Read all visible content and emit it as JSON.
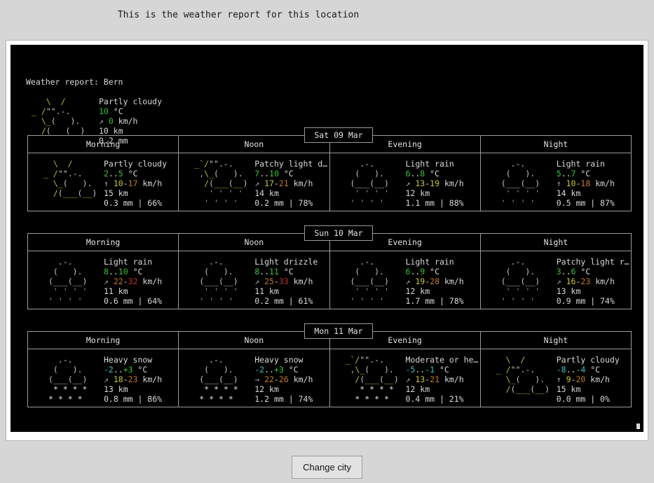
{
  "page": {
    "heading": "This is the weather report for this location",
    "button_label": "Change city"
  },
  "colors": {
    "background": "#d6d6d6",
    "terminal_bg": "#000000",
    "terminal_fg": "#d0d0d0",
    "frame": "#ffffff",
    "green": "#35c135",
    "cyan": "#34c3cb",
    "yellow": "#c7c72f",
    "orange": "#c07a20",
    "red": "#c23030",
    "sun": "#a6c52b"
  },
  "report": {
    "title": "Weather report: Bern",
    "location": "Bern",
    "current": {
      "art": [
        "   \\  /",
        "_ /\"\".-.",
        "  \\_(   ).",
        "  /(___(__)"
      ],
      "condition": "Partly cloudy",
      "temp": "10",
      "temp_unit": "°C",
      "wind_arrow": "↗",
      "wind": "0",
      "wind_unit": "km/h",
      "visibility": "10 km",
      "precip": "0.2 mm"
    }
  },
  "days": [
    {
      "label": "Sat 09 Mar",
      "slots": [
        {
          "name": "Morning",
          "art": [
            "  \\  /",
            "_ /\"\".-.",
            "  \\_(   ).",
            "  /(___(__)"
          ],
          "art_kind": "sun-cloud",
          "condition": "Partly cloudy",
          "temp_low": "2",
          "temp_high": "5",
          "temp_low_color": "green",
          "temp_high_color": "green",
          "temp_text": "2..5 °C",
          "wind_arrow": "↑",
          "wind_low": "10",
          "wind_high": "17",
          "wind_low_color": "yellow",
          "wind_high_color": "orange",
          "wind_text": "10-17 km/h",
          "visibility": "15 km",
          "precip": "0.3 mm | 66%"
        },
        {
          "name": "Noon",
          "art": [
            "_`/\"\".-.",
            " ,\\_(   ).",
            "  /(___(__)",
            "   ' ' ' '",
            "  ' ' ' '"
          ],
          "art_kind": "sun-cloud-rain",
          "condition": "Patchy light d…",
          "temp_low": "7",
          "temp_high": "10",
          "temp_low_color": "green",
          "temp_high_color": "green",
          "temp_text": "7..10 °C",
          "wind_arrow": "↗",
          "wind_low": "17",
          "wind_high": "21",
          "wind_low_color": "yellow",
          "wind_high_color": "orange",
          "wind_text": "17-21 km/h",
          "visibility": "14 km",
          "precip": "0.2 mm | 78%"
        },
        {
          "name": "Evening",
          "art": [
            "   .-.",
            "  (   ).",
            " (___(__)",
            "  ' ' ' '",
            " ' ' ' '"
          ],
          "art_kind": "rain",
          "condition": "Light rain",
          "temp_low": "6",
          "temp_high": "8",
          "temp_low_color": "green",
          "temp_high_color": "green",
          "temp_text": "6..8 °C",
          "wind_arrow": "↗",
          "wind_low": "13",
          "wind_high": "19",
          "wind_low_color": "yellow",
          "wind_high_color": "yellow",
          "wind_text": "13-19 km/h",
          "visibility": "12 km",
          "precip": "1.1 mm | 88%"
        },
        {
          "name": "Night",
          "art": [
            "   .-.",
            "  (   ).",
            " (___(__)",
            "  ' ' ' '",
            " ' ' ' '"
          ],
          "art_kind": "rain",
          "condition": "Light rain",
          "temp_low": "5",
          "temp_high": "7",
          "temp_low_color": "green",
          "temp_high_color": "green",
          "temp_text": "5..7 °C",
          "wind_arrow": "↑",
          "wind_low": "10",
          "wind_high": "18",
          "wind_low_color": "yellow",
          "wind_high_color": "orange",
          "wind_text": "10-18 km/h",
          "visibility": "14 km",
          "precip": "0.5 mm | 87%"
        }
      ]
    },
    {
      "label": "Sun 10 Mar",
      "slots": [
        {
          "name": "Morning",
          "art": [
            "   .-.",
            "  (   ).",
            " (___(__)",
            "  ' ' ' '",
            " ' ' ' '"
          ],
          "art_kind": "rain",
          "condition": "Light rain",
          "temp_low": "8",
          "temp_high": "10",
          "temp_low_color": "green",
          "temp_high_color": "green",
          "temp_text": "8..10 °C",
          "wind_arrow": "↗",
          "wind_low": "22",
          "wind_high": "32",
          "wind_low_color": "orange",
          "wind_high_color": "red",
          "wind_text": "22-32 km/h",
          "visibility": "11 km",
          "precip": "0.6 mm | 64%"
        },
        {
          "name": "Noon",
          "art": [
            "   .-.",
            "  (   ).",
            " (___(__)",
            "  ' ' ' '",
            " ' ' ' '"
          ],
          "art_kind": "rain",
          "condition": "Light drizzle",
          "temp_low": "8",
          "temp_high": "11",
          "temp_low_color": "green",
          "temp_high_color": "green",
          "temp_text": "8..11 °C",
          "wind_arrow": "↗",
          "wind_low": "25",
          "wind_high": "33",
          "wind_low_color": "orange",
          "wind_high_color": "red",
          "wind_text": "25-33 km/h",
          "visibility": "11 km",
          "precip": "0.2 mm | 61%"
        },
        {
          "name": "Evening",
          "art": [
            "   .-.",
            "  (   ).",
            " (___(__)",
            "  ' ' ' '",
            " ' ' ' '"
          ],
          "art_kind": "rain",
          "condition": "Light rain",
          "temp_low": "6",
          "temp_high": "9",
          "temp_low_color": "green",
          "temp_high_color": "green",
          "temp_text": "6..9 °C",
          "wind_arrow": "↗",
          "wind_low": "19",
          "wind_high": "28",
          "wind_low_color": "yellow",
          "wind_high_color": "orange",
          "wind_text": "19-28 km/h",
          "visibility": "12 km",
          "precip": "1.7 mm | 78%"
        },
        {
          "name": "Night",
          "art": [
            "   .-.",
            "  (   ).",
            " (___(__)",
            "  ' ' ' '",
            " ' ' ' '"
          ],
          "art_kind": "rain",
          "condition": "Patchy light r…",
          "temp_low": "3",
          "temp_high": "6",
          "temp_low_color": "green",
          "temp_high_color": "green",
          "temp_text": "3..6 °C",
          "wind_arrow": "↗",
          "wind_low": "16",
          "wind_high": "23",
          "wind_low_color": "yellow",
          "wind_high_color": "orange",
          "wind_text": "16-23 km/h",
          "visibility": "13 km",
          "precip": "0.9 mm | 74%"
        }
      ]
    },
    {
      "label": "Mon 11 Mar",
      "slots": [
        {
          "name": "Morning",
          "art": [
            "   .-.",
            "  (   ).",
            " (___(__)",
            "  * * * *",
            " * * * *"
          ],
          "art_kind": "snow",
          "condition": "Heavy snow",
          "temp_low": "-2",
          "temp_high": "+3",
          "temp_low_color": "cyan",
          "temp_high_color": "green",
          "temp_text": "-2..+3 °C",
          "wind_arrow": "↗",
          "wind_low": "18",
          "wind_high": "23",
          "wind_low_color": "yellow",
          "wind_high_color": "orange",
          "wind_text": "18-23 km/h",
          "visibility": "13 km",
          "precip": "0.8 mm | 86%"
        },
        {
          "name": "Noon",
          "art": [
            "   .-.",
            "  (   ).",
            " (___(__)",
            "  * * * *",
            " * * * *"
          ],
          "art_kind": "snow",
          "condition": "Heavy snow",
          "temp_low": "-2",
          "temp_high": "+3",
          "temp_low_color": "cyan",
          "temp_high_color": "green",
          "temp_text": "-2..+3 °C",
          "wind_arrow": "→",
          "wind_low": "22",
          "wind_high": "26",
          "wind_low_color": "orange",
          "wind_high_color": "orange",
          "wind_text": "22-26 km/h",
          "visibility": "12 km",
          "precip": "1.2 mm | 74%"
        },
        {
          "name": "Evening",
          "art": [
            "_`/\"\".-.",
            " ,\\_(   ).",
            "  /(___(__)",
            "   * * * *",
            "  * * * *"
          ],
          "art_kind": "sun-cloud-snow",
          "condition": "Moderate or he…",
          "temp_low": "-5",
          "temp_high": "-1",
          "temp_low_color": "cyan",
          "temp_high_color": "cyan",
          "temp_text": "-5..-1 °C",
          "wind_arrow": "↗",
          "wind_low": "13",
          "wind_high": "21",
          "wind_low_color": "yellow",
          "wind_high_color": "orange",
          "wind_text": "13-21 km/h",
          "visibility": "12 km",
          "precip": "0.4 mm | 21%"
        },
        {
          "name": "Night",
          "art": [
            "  \\  /",
            "_ /\"\".-.",
            "  \\_(   ).",
            "  /(___(__)"
          ],
          "art_kind": "sun-cloud",
          "condition": "Partly cloudy",
          "temp_low": "-8",
          "temp_high": "-4",
          "temp_low_color": "cyan",
          "temp_high_color": "cyan",
          "temp_text": "-8..-4 °C",
          "wind_arrow": "↑",
          "wind_low": "9",
          "wind_high": "20",
          "wind_low_color": "yellow",
          "wind_high_color": "orange",
          "wind_text": "9-20 km/h",
          "visibility": "15 km",
          "precip": "0.0 mm | 0%"
        }
      ]
    }
  ],
  "labels": {
    "temp_unit": "°C",
    "wind_unit": "km/h"
  }
}
